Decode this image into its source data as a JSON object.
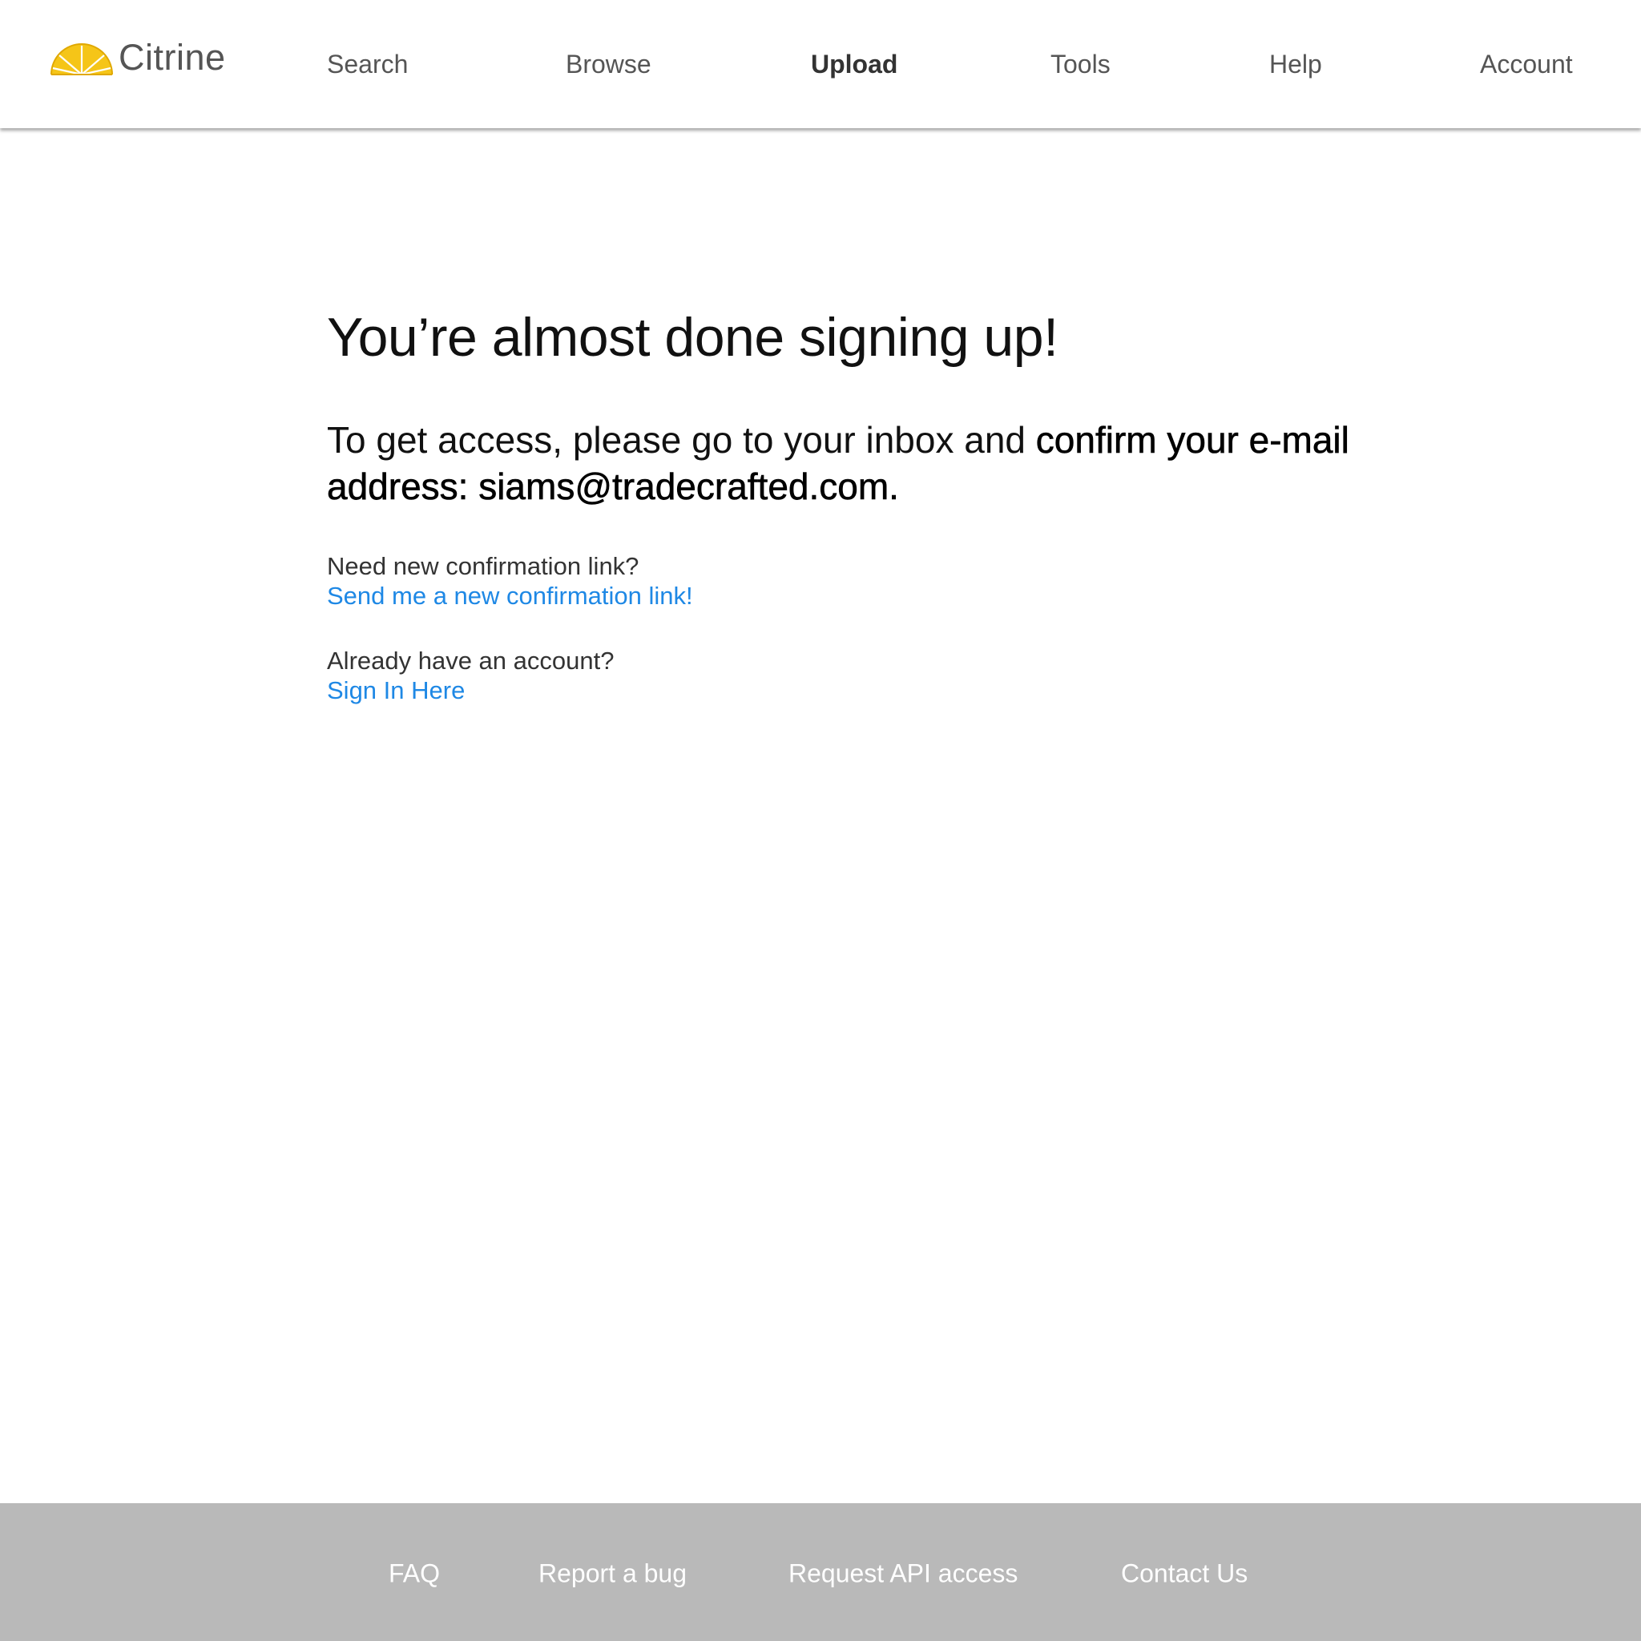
{
  "brand": {
    "name": "Citrine",
    "logo_icon": "citrine-slice-icon",
    "logo_color": "#F5C518"
  },
  "nav": {
    "items": [
      {
        "label": "Search"
      },
      {
        "label": "Browse"
      },
      {
        "label": "Upload",
        "active": true
      },
      {
        "label": "Tools"
      },
      {
        "label": "Help"
      },
      {
        "label": "Account"
      }
    ]
  },
  "main": {
    "title": "You’re almost done signing up!",
    "instructions_prefix": "To get access, please go to your inbox and ",
    "instructions_emphasis": "confirm your e-mail address: siams@tradecrafted.com.",
    "resend": {
      "question": "Need new confirmation link?",
      "link": "Send me a new confirmation link!"
    },
    "signin": {
      "question": "Already have an account?",
      "link": "Sign In Here"
    }
  },
  "footer": {
    "links": [
      {
        "label": "FAQ"
      },
      {
        "label": "Report a bug"
      },
      {
        "label": "Request API access"
      },
      {
        "label": "Contact Us"
      }
    ]
  },
  "colors": {
    "link": "#1e88e5",
    "footer_bg": "#b9b9b9",
    "nav_text": "#555555"
  }
}
